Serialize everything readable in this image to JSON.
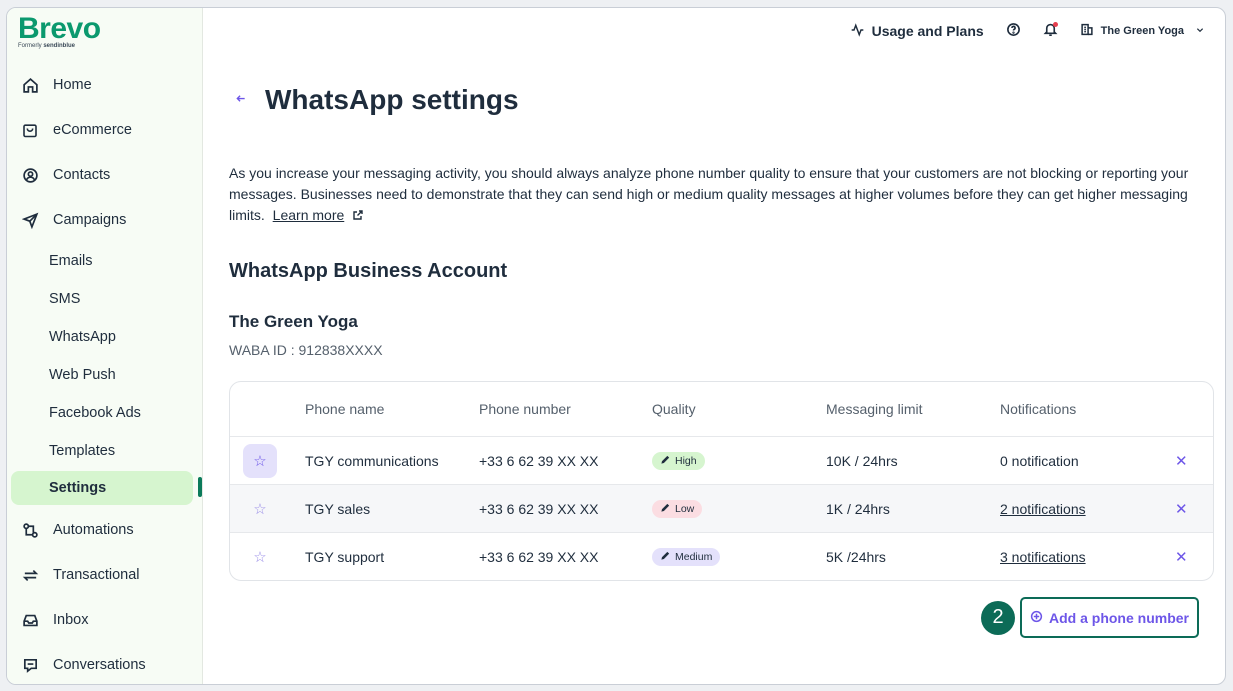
{
  "brand": {
    "name": "Brevo",
    "formerly": "Formerly",
    "formerly_brand": "sendinblue"
  },
  "sidebar": {
    "items": [
      {
        "label": "Home",
        "icon": "home-icon"
      },
      {
        "label": "eCommerce",
        "icon": "shopping-bag-icon"
      },
      {
        "label": "Contacts",
        "icon": "contacts-icon"
      },
      {
        "label": "Campaigns",
        "icon": "send-icon"
      },
      {
        "label": "Emails"
      },
      {
        "label": "SMS"
      },
      {
        "label": "WhatsApp"
      },
      {
        "label": "Web Push"
      },
      {
        "label": "Facebook Ads"
      },
      {
        "label": "Templates"
      },
      {
        "label": "Settings",
        "active": true
      },
      {
        "label": "Automations",
        "icon": "automation-icon"
      },
      {
        "label": "Transactional",
        "icon": "transactional-icon"
      },
      {
        "label": "Inbox",
        "icon": "inbox-icon"
      },
      {
        "label": "Conversations",
        "icon": "chat-icon"
      }
    ]
  },
  "topbar": {
    "usage_label": "Usage and Plans",
    "org_name": "The Green Yoga"
  },
  "page": {
    "title": "WhatsApp settings",
    "description": "As you increase your messaging activity, you should always analyze phone number quality to ensure that your customers are not blocking or reporting your messages. Businesses need to demonstrate that they can send high or medium quality messages at higher volumes before they can get higher messaging limits.",
    "learn_more": "Learn more",
    "section_title": "WhatsApp Business Account",
    "account_name": "The Green Yoga",
    "waba_id": "WABA ID : 912838XXXX"
  },
  "table": {
    "headers": [
      "Phone name",
      "Phone number",
      "Quality",
      "Messaging limit",
      "Notifications"
    ],
    "rows": [
      {
        "name": "TGY communications",
        "phone": "+33 6 62 39 XX XX",
        "quality": "High",
        "limit": "10K / 24hrs",
        "notifications": "0 notification"
      },
      {
        "name": "TGY sales",
        "phone": "+33 6 62 39 XX XX",
        "quality": "Low",
        "limit": "1K / 24hrs",
        "notifications": "2 notifications"
      },
      {
        "name": "TGY support",
        "phone": "+33 6 62 39 XX XX",
        "quality": "Medium",
        "limit": "5K /24hrs",
        "notifications": "3 notifications"
      }
    ]
  },
  "add_phone": {
    "step": "2",
    "label": "Add a phone number"
  },
  "colors": {
    "brand_green": "#0b996e",
    "accent_purple": "#6d56e8",
    "step_green": "#0c6b57"
  }
}
